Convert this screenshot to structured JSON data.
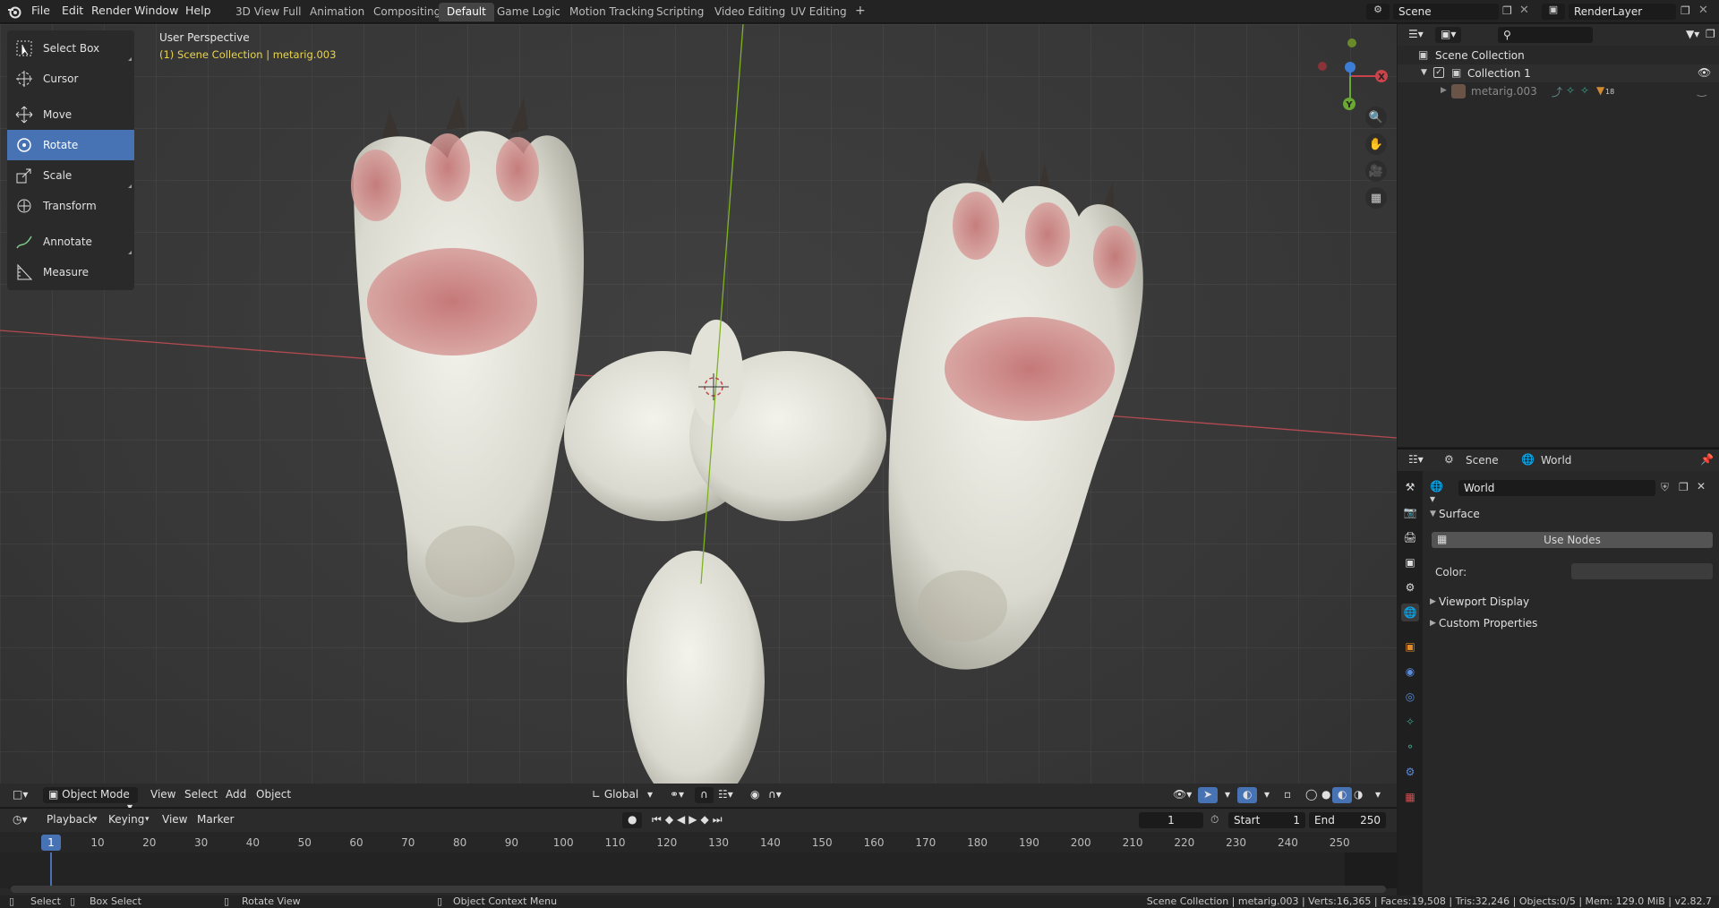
{
  "topbar": {
    "menus": [
      "File",
      "Edit",
      "Render",
      "Window",
      "Help"
    ],
    "workspaces": [
      "3D View Full",
      "Animation",
      "Compositing",
      "Default",
      "Game Logic",
      "Motion Tracking",
      "Scripting",
      "Video Editing",
      "UV Editing"
    ],
    "active_workspace": "Default",
    "add_tab": "+",
    "scene_name": "Scene",
    "render_layer": "RenderLayer"
  },
  "tools": {
    "select_box": "Select Box",
    "cursor": "Cursor",
    "move": "Move",
    "rotate": "Rotate",
    "scale": "Scale",
    "transform": "Transform",
    "annotate": "Annotate",
    "measure": "Measure",
    "active": "Rotate"
  },
  "viewport": {
    "perspective_label": "User Perspective",
    "collection_label": "(1) Scene Collection | metarig.003",
    "gizmo_x": "X",
    "gizmo_y": "Y"
  },
  "viewport_header": {
    "mode": "Object Mode",
    "view": "View",
    "select": "Select",
    "add": "Add",
    "object": "Object",
    "orientation": "Global"
  },
  "timeline": {
    "playback": "Playback",
    "keying": "Keying",
    "view": "View",
    "marker": "Marker",
    "current_frame": "1",
    "start_label": "Start",
    "start_value": "1",
    "end_label": "End",
    "end_value": "250",
    "ruler": [
      "10",
      "20",
      "30",
      "40",
      "50",
      "60",
      "70",
      "80",
      "90",
      "100",
      "110",
      "120",
      "130",
      "140",
      "150",
      "160",
      "170",
      "180",
      "190",
      "200",
      "210",
      "220",
      "230",
      "240",
      "250"
    ],
    "playhead": "1"
  },
  "statusbar": {
    "select": "Select",
    "box_select": "Box Select",
    "rotate_view": "Rotate View",
    "context_menu": "Object Context Menu",
    "stats": "Scene Collection | metarig.003 | Verts:16,365 | Faces:19,508 | Tris:32,246 | Objects:0/5 | Mem: 129.0 MiB | v2.82.7"
  },
  "outliner": {
    "scene_collection": "Scene Collection",
    "collection": "Collection 1",
    "object": "metarig.003",
    "badge": "18"
  },
  "properties": {
    "scene_tab": "Scene",
    "world_tab": "World",
    "world_name": "World",
    "surface": "Surface",
    "use_nodes": "Use Nodes",
    "color_label": "Color:",
    "viewport_display": "Viewport Display",
    "custom_properties": "Custom Properties"
  },
  "colors": {
    "accent": "#4772b3",
    "x_axis": "#c9434b",
    "y_axis": "#6aa834",
    "z_axis": "#3d7dd8",
    "label_yellow": "#e8d44d"
  }
}
